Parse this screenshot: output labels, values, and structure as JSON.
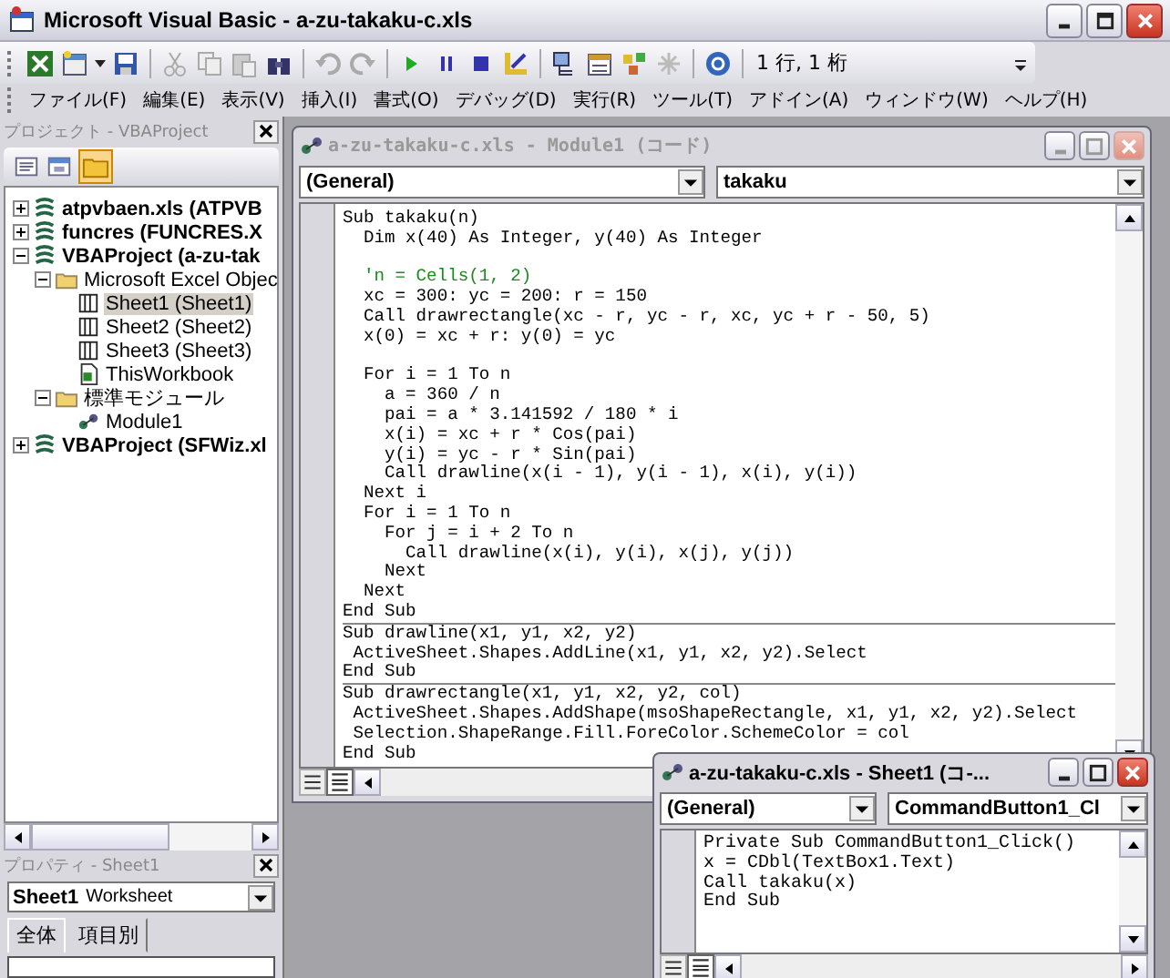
{
  "window": {
    "title": "Microsoft Visual Basic - a-zu-takaku-c.xls"
  },
  "toolbar": {
    "position": "1 行, 1 桁"
  },
  "menu": [
    "ファイル(F)",
    "編集(E)",
    "表示(V)",
    "挿入(I)",
    "書式(O)",
    "デバッグ(D)",
    "実行(R)",
    "ツール(T)",
    "アドイン(A)",
    "ウィンドウ(W)",
    "ヘルプ(H)"
  ],
  "project_explorer": {
    "title": "プロジェクト - VBAProject",
    "tree": [
      {
        "label": "atpvbaen.xls (ATPVB",
        "kind": "project",
        "expanded": false,
        "selected": false
      },
      {
        "label": "funcres (FUNCRES.X",
        "kind": "project",
        "expanded": false,
        "selected": false
      },
      {
        "label": "VBAProject (a-zu-tak",
        "kind": "project",
        "expanded": true,
        "selected": false,
        "children": [
          {
            "label": "Microsoft Excel Objec",
            "kind": "folder",
            "expanded": true,
            "selected": false,
            "children": [
              {
                "label": "Sheet1 (Sheet1)",
                "kind": "sheet",
                "selected": true
              },
              {
                "label": "Sheet2 (Sheet2)",
                "kind": "sheet",
                "selected": false
              },
              {
                "label": "Sheet3 (Sheet3)",
                "kind": "sheet",
                "selected": false
              },
              {
                "label": "ThisWorkbook",
                "kind": "workbook",
                "selected": false
              }
            ]
          },
          {
            "label": "標準モジュール",
            "kind": "folder",
            "expanded": true,
            "selected": false,
            "children": [
              {
                "label": "Module1",
                "kind": "module",
                "selected": false
              }
            ]
          }
        ]
      },
      {
        "label": "VBAProject (SFWiz.xl",
        "kind": "project",
        "expanded": false,
        "selected": false
      }
    ]
  },
  "properties": {
    "title": "プロパティ - Sheet1",
    "object": "Sheet1",
    "object_type": "Worksheet",
    "tabs": [
      {
        "label": "全体",
        "selected": true
      },
      {
        "label": "項目別",
        "selected": false
      }
    ]
  },
  "code_windows": [
    {
      "title": "a-zu-takaku-c.xls - Module1 (コード)",
      "active": false,
      "object": "(General)",
      "procedure": "takaku",
      "procedures": [
        {
          "lines": [
            {
              "kind": "code",
              "text": "Sub takaku(n)"
            },
            {
              "kind": "code",
              "text": "  Dim x(40) As Integer, y(40) As Integer"
            },
            {
              "kind": "blank"
            },
            {
              "kind": "comment",
              "text": "  'n = Cells(1, 2)"
            },
            {
              "kind": "code",
              "text": "  xc = 300: yc = 200: r = 150"
            },
            {
              "kind": "code",
              "text": "  Call drawrectangle(xc - r, yc - r, xc, yc + r - 50, 5)"
            },
            {
              "kind": "code",
              "text": "  x(0) = xc + r: y(0) = yc"
            },
            {
              "kind": "blank"
            },
            {
              "kind": "code",
              "text": "  For i = 1 To n"
            },
            {
              "kind": "code",
              "text": "    a = 360 / n"
            },
            {
              "kind": "code",
              "text": "    pai = a * 3.141592 / 180 * i"
            },
            {
              "kind": "code",
              "text": "    x(i) = xc + r * Cos(pai)"
            },
            {
              "kind": "code",
              "text": "    y(i) = yc - r * Sin(pai)"
            },
            {
              "kind": "code",
              "text": "    Call drawline(x(i - 1), y(i - 1), x(i), y(i))"
            },
            {
              "kind": "code",
              "text": "  Next i"
            },
            {
              "kind": "code",
              "text": "  For i = 1 To n"
            },
            {
              "kind": "code",
              "text": "    For j = i + 2 To n"
            },
            {
              "kind": "code",
              "text": "      Call drawline(x(i), y(i), x(j), y(j))"
            },
            {
              "kind": "code",
              "text": "    Next"
            },
            {
              "kind": "code",
              "text": "  Next"
            },
            {
              "kind": "code",
              "text": "End Sub"
            }
          ]
        },
        {
          "lines": [
            {
              "kind": "code",
              "text": "Sub drawline(x1, y1, x2, y2)"
            },
            {
              "kind": "code",
              "text": " ActiveSheet.Shapes.AddLine(x1, y1, x2, y2).Select"
            },
            {
              "kind": "code",
              "text": "End Sub"
            }
          ]
        },
        {
          "lines": [
            {
              "kind": "code",
              "text": "Sub drawrectangle(x1, y1, x2, y2, col)"
            },
            {
              "kind": "code",
              "text": " ActiveSheet.Shapes.AddShape(msoShapeRectangle, x1, y1, x2, y2).Select"
            },
            {
              "kind": "code",
              "text": " Selection.ShapeRange.Fill.ForeColor.SchemeColor = col"
            },
            {
              "kind": "code",
              "text": "End Sub"
            }
          ]
        }
      ]
    },
    {
      "title": "a-zu-takaku-c.xls - Sheet1 (コ-...",
      "active": true,
      "object": "(General)",
      "procedure": "CommandButton1_Cl",
      "procedures": [
        {
          "lines": [
            {
              "kind": "code",
              "text": "Private Sub CommandButton1_Click()"
            },
            {
              "kind": "code",
              "text": "x = CDbl(TextBox1.Text)"
            },
            {
              "kind": "code",
              "text": "Call takaku(x)"
            },
            {
              "kind": "code",
              "text": "End Sub"
            }
          ]
        }
      ]
    }
  ]
}
